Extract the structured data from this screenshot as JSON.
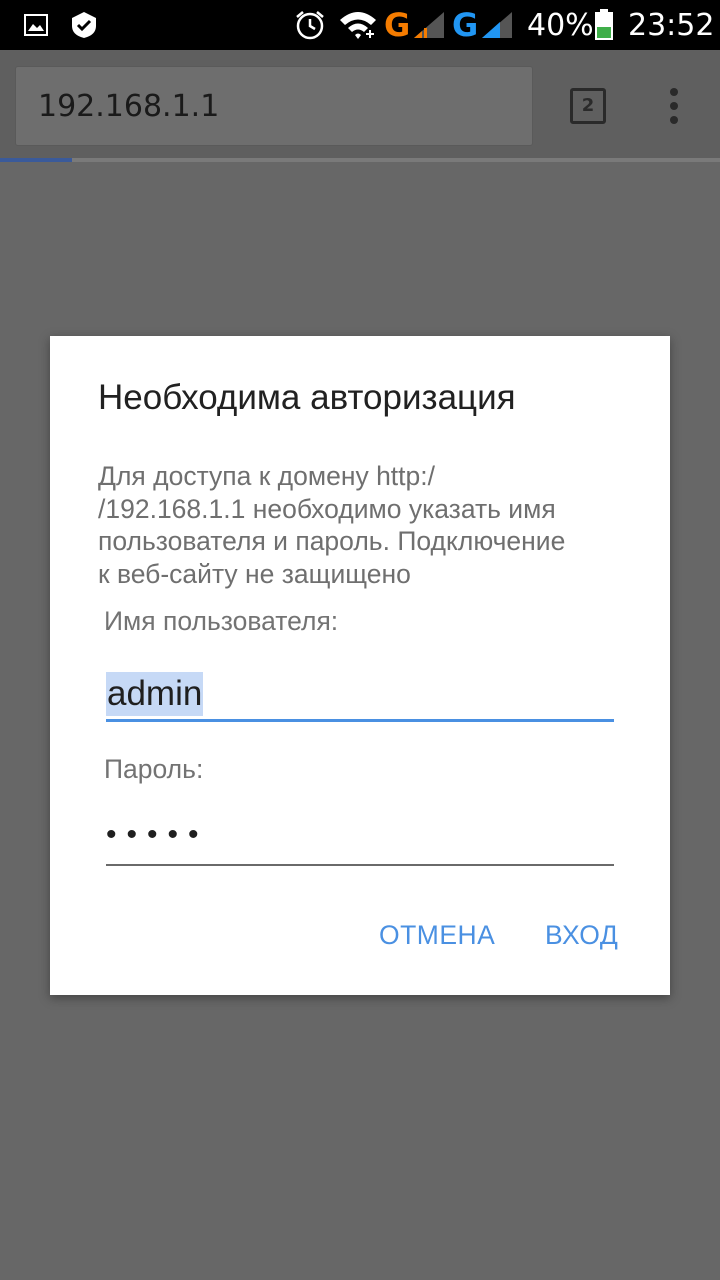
{
  "status_bar": {
    "signal_1": "G",
    "signal_2": "G",
    "battery": "40%",
    "time": "23:52",
    "colors": {
      "signal_1": "#f57c00",
      "signal_2": "#2196f3",
      "battery_fill": "#3fae49"
    },
    "icons": [
      "image-icon",
      "check-shield-icon",
      "alarm-icon",
      "wifi-icon",
      "cell-signal-icon",
      "cell-signal-icon",
      "battery-icon"
    ]
  },
  "browser": {
    "url": "192.168.1.1",
    "tab_count": "2",
    "load_progress": 0.1
  },
  "dialog": {
    "title": "Необходима авторизация",
    "message": "Для доступа к домену http:/\n/192.168.1.1 необходимо указать имя\nпользователя и пароль. Подключение\nк веб-сайту не защищено",
    "username_label": "Имя пользователя:",
    "username_value": "admin",
    "password_label": "Пароль:",
    "password_value": "•••••",
    "cancel_label": "ОТМЕНА",
    "login_label": "ВХОД",
    "colors": {
      "accent": "#4a90e2",
      "selection": "#c6d9f6"
    }
  }
}
